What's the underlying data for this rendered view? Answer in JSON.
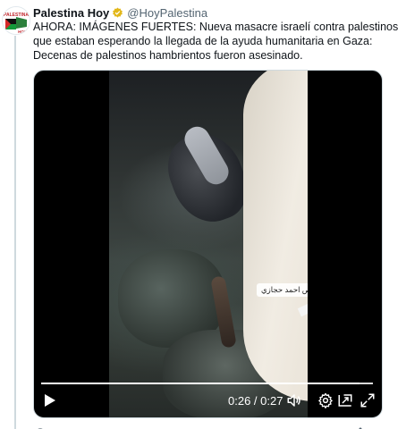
{
  "tweet": {
    "author_name": "Palestina Hoy",
    "author_handle": "@HoyPalestina",
    "avatar_text": "PALESTINA HOY",
    "text": "AHORA: IMÁGENES FUERTES: Nueva masacre israelí contra palestinos que estaban esperando la llegada de la ayuda humanitaria en Gaza: Decenas de palestinos hambrientos fueron asesinado."
  },
  "video": {
    "watermark_text": "خاص احمد حجازي",
    "time_display": "0:26 / 0:27",
    "progress": 0.96
  },
  "icons": {
    "verified": "verified-badge-icon",
    "play": "play-icon",
    "volume": "volume-icon",
    "settings": "gear-icon",
    "pip": "picture-in-picture-icon",
    "fullscreen": "fullscreen-icon"
  },
  "colors": {
    "verified_gold": "#e2b719",
    "handle_gray": "#536471",
    "progress_white": "#ffffff"
  }
}
